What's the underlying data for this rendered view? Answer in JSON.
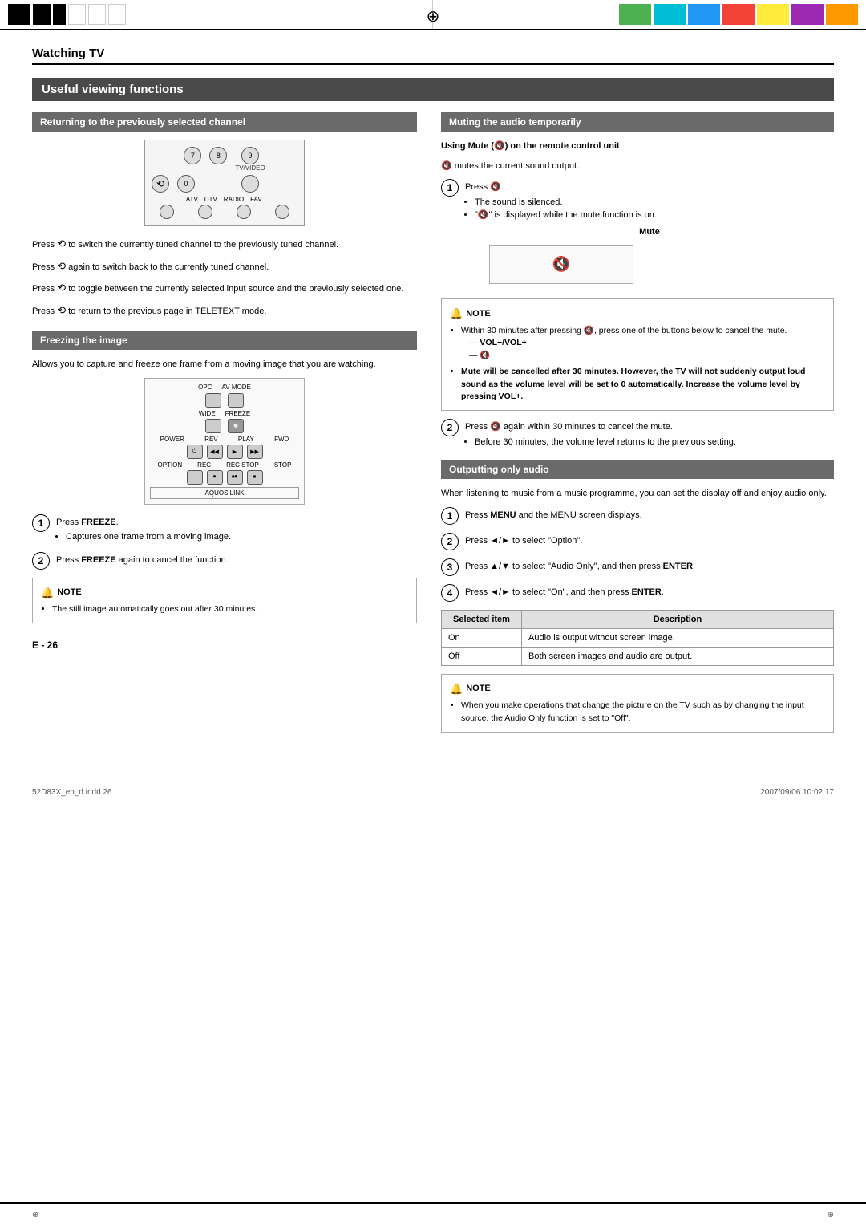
{
  "header": {
    "watching_tv": "Watching TV",
    "compass_icon": "⊕"
  },
  "section_title": "Useful viewing functions",
  "left_col": {
    "returning_header": "Returning to the previously selected channel",
    "returning_body1": "Press  to switch the currently tuned channel to the previously tuned channel.",
    "returning_body2": "Press  again to switch back to the currently tuned channel.",
    "returning_body3": "Press  to toggle between the currently selected input source and the previously selected one.",
    "returning_body4": "Press  to return to the previous page in TELETEXT mode.",
    "freezing_header": "Freezing the image",
    "freezing_body": "Allows you to capture and freeze one frame from a moving image that you are watching.",
    "step1_freeze": "Press FREEZE.",
    "step1_freeze_bullet": "Captures one frame from a moving image.",
    "step2_freeze": "Press FREEZE again to cancel the function.",
    "note_freeze": "The still image automatically goes out after 30 minutes."
  },
  "right_col": {
    "muting_header": "Muting the audio temporarily",
    "using_mute_title": "Using Mute (🔇) on the remote control unit",
    "using_mute_desc": "🔇 mutes the current sound output.",
    "mute_step1": "Press 🔇.",
    "mute_step1_b1": "The sound is silenced.",
    "mute_step1_b2": "\"🔇\" is displayed while the mute function is on.",
    "mute_label": "Mute",
    "note_mute1": "Within 30 minutes after pressing 🔇, press one of the buttons below to cancel the mute.",
    "note_mute1_b1": "— VOL−/VOL+",
    "note_mute1_b2": "— 🔇",
    "note_mute2": "Mute will be cancelled after 30 minutes. However, the TV will not suddenly output loud sound as the volume level will be set to 0 automatically. Increase the volume level by pressing VOL+.",
    "mute_step2": "Press 🔇 again within 30 minutes to cancel the mute.",
    "mute_step2_bullet": "Before 30 minutes, the volume level returns to the previous setting.",
    "outputting_header": "Outputting only audio",
    "outputting_body": "When listening to music from a music programme, you can set the display off and enjoy audio only.",
    "out_step1": "Press MENU and the MENU screen displays.",
    "out_step2": "Press ◄/► to select \"Option\".",
    "out_step3": "Press ▲/▼ to select \"Audio Only\", and then press ENTER.",
    "out_step4": "Press ◄/► to select \"On\", and then press ENTER.",
    "table_col1": "Selected item",
    "table_col2": "Description",
    "table_row1_item": "On",
    "table_row1_desc": "Audio is output without screen image.",
    "table_row2_item": "Off",
    "table_row2_desc": "Both screen images and audio are output.",
    "note_output": "When you make operations that change the picture on the TV such as by changing the input source, the Audio Only function is set to \"Off\"."
  },
  "footer": {
    "page_num": "E - 26",
    "file_left": "52D83X_en_d.indd  26",
    "file_right": "2007/09/06  10:02:17"
  },
  "remote_buttons": {
    "num7": "7",
    "num8": "8",
    "num9": "9",
    "tv_video": "TV/VIDEO",
    "swap": "⟲",
    "num0": "0",
    "atv": "ATV",
    "dtv": "DTV",
    "radio": "RADIO",
    "fav": "FAV."
  },
  "freeze_buttons": {
    "opc": "OPC",
    "av_mode": "AV MODE",
    "wide": "WIDE",
    "freeze": "FREEZE",
    "power": "POWER",
    "rev": "REV",
    "play": "PLAY",
    "fwd": "FWD",
    "option": "OPTION",
    "rec": "REC",
    "rec_stop": "REC STOP",
    "stop": "STOP",
    "aquos_link": "AQUOS LINK"
  }
}
